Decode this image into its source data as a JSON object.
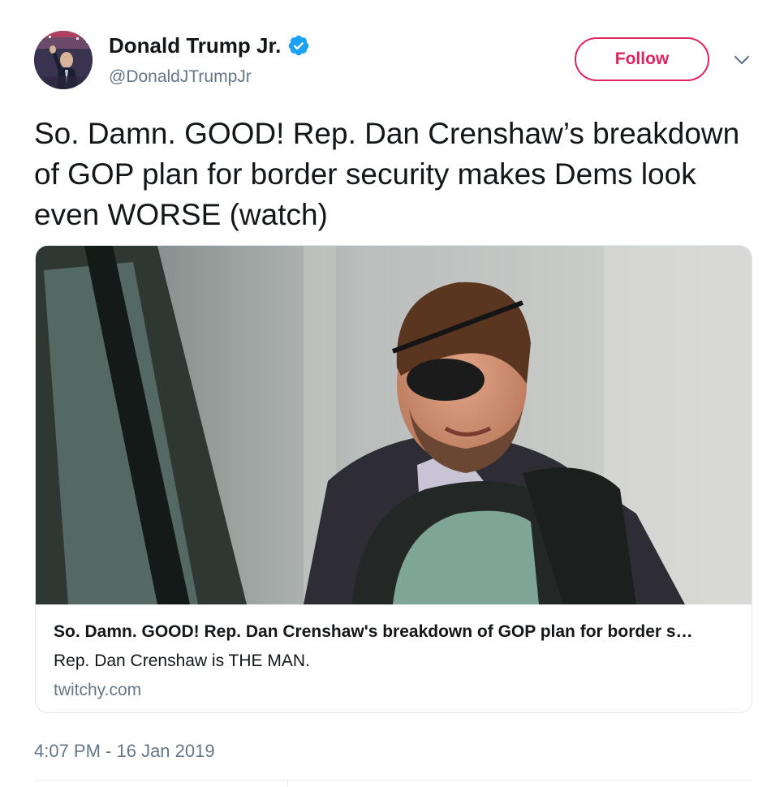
{
  "author": {
    "name": "Donald Trump Jr.",
    "handle": "@DonaldJTrumpJr",
    "verified_icon": "verified-badge-icon"
  },
  "header": {
    "follow_label": "Follow",
    "menu_icon": "chevron-down-icon"
  },
  "tweet": {
    "text": "So. Damn. GOOD! Rep. Dan Crenshaw’s breakdown of GOP plan for border security makes Dems look even WORSE (watch)",
    "timestamp": "4:07 PM - 16 Jan 2019"
  },
  "card": {
    "title": "So. Damn. GOOD! Rep. Dan Crenshaw's breakdown of GOP plan for border s…",
    "description": "Rep. Dan Crenshaw is THE MAN.",
    "domain": "twitchy.com"
  },
  "colors": {
    "accent": "#e0245e",
    "verified": "#1da1f2",
    "secondary_text": "#657786",
    "border": "#e1e8ed"
  }
}
